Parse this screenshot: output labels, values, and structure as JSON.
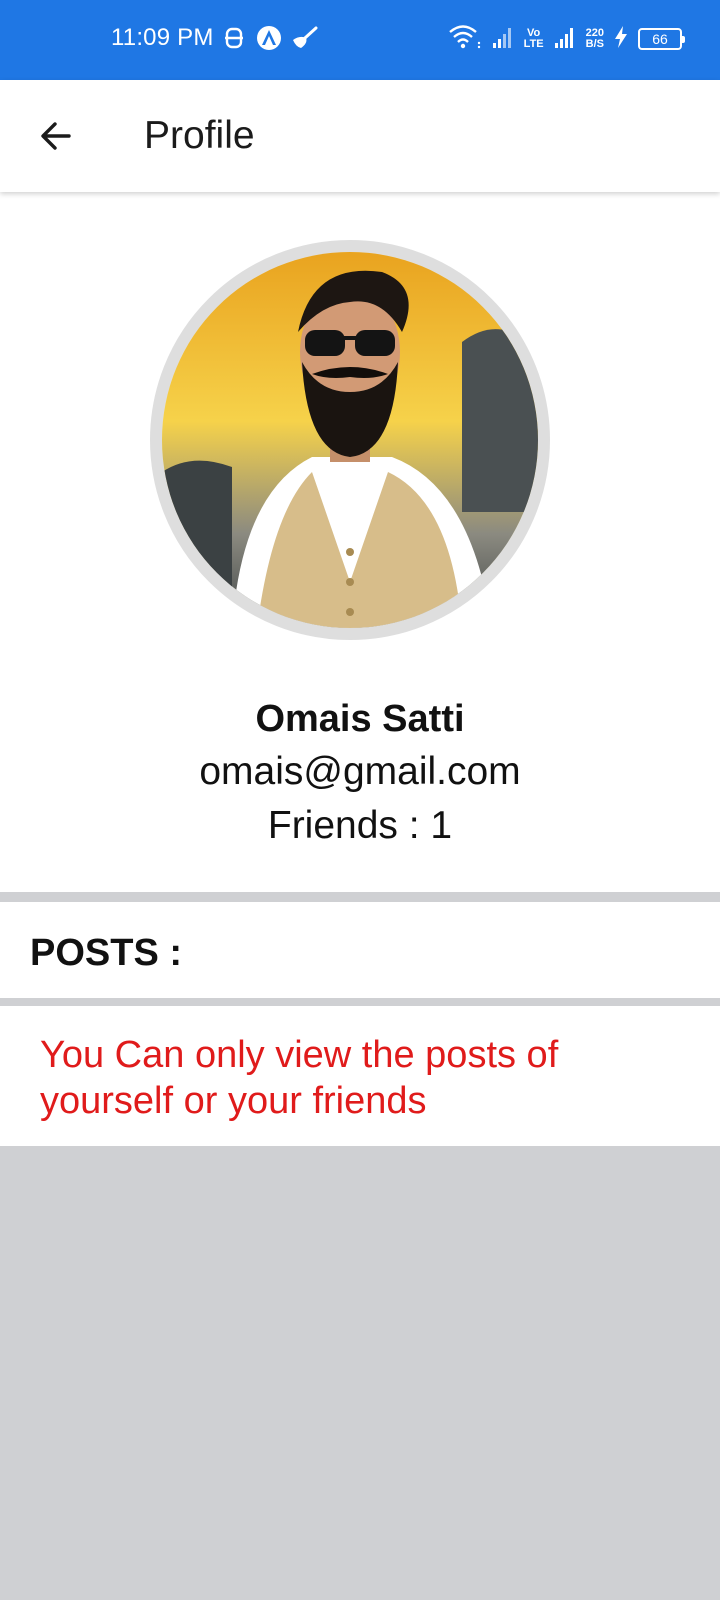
{
  "status_bar": {
    "time": "11:09 PM",
    "network_speed_value": "220",
    "network_speed_unit": "B/S",
    "volte_top": "Vo",
    "volte_bottom": "LTE",
    "battery": "66",
    "background_color": "#1f77e4"
  },
  "app_bar": {
    "title": "Profile",
    "back_icon": "arrow-left-icon"
  },
  "profile": {
    "name": "Omais Satti",
    "email": "omais@gmail.com",
    "friends": "Friends : 1",
    "avatar": "profile-photo"
  },
  "posts": {
    "header": "POSTS :",
    "notice": "You Can only view the posts of yourself or your friends",
    "notice_color": "#e01b1b"
  }
}
